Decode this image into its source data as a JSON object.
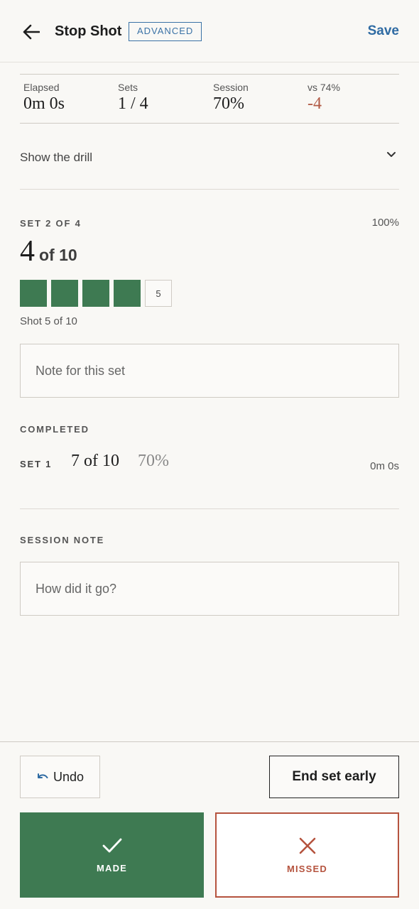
{
  "header": {
    "title": "Stop Shot",
    "badge": "ADVANCED",
    "save_label": "Save"
  },
  "stats": [
    {
      "label": "Elapsed",
      "value": "0m 0s"
    },
    {
      "label": "Sets",
      "value": "1 / 4"
    },
    {
      "label": "Session",
      "value": "70%"
    },
    {
      "label": "vs 74%",
      "value": "-4"
    }
  ],
  "drill": {
    "toggle_label": "Show the drill"
  },
  "current_set": {
    "title": "SET 2 OF 4",
    "percent": "100%",
    "made": "4",
    "of_total": "of 10",
    "made_shots": 4,
    "current_shot_number": "5",
    "caption": "Shot 5 of 10",
    "note_placeholder": "Note for this set"
  },
  "completed": {
    "title": "COMPLETED",
    "sets": [
      {
        "label": "SET 1",
        "score": "7 of 10",
        "percent": "70%",
        "time": "0m 0s"
      }
    ]
  },
  "session_note": {
    "title": "SESSION NOTE",
    "placeholder": "How did it go?"
  },
  "footer": {
    "undo_label": "Undo",
    "end_set_label": "End set early",
    "made_label": "MADE",
    "missed_label": "MISSED"
  },
  "colors": {
    "made": "#3e7a52",
    "missed": "#b5533e",
    "accent": "#2f6ba3",
    "negative": "#b15a45"
  },
  "icons": {
    "back": "arrow-left-icon",
    "chevron": "chevron-down-icon",
    "undo": "undo-icon",
    "made": "check-icon",
    "missed": "x-icon"
  }
}
